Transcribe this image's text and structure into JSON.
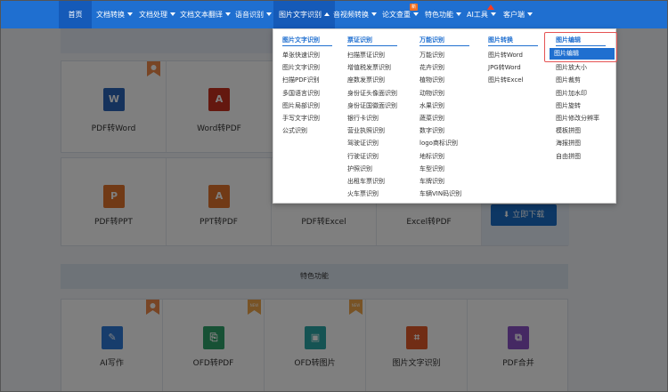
{
  "nav": {
    "items": [
      {
        "label": "首页"
      },
      {
        "label": "文档转换"
      },
      {
        "label": "文档处理"
      },
      {
        "label": "文档文本翻译"
      },
      {
        "label": "语音识别"
      },
      {
        "label": "图片文字识别"
      },
      {
        "label": "音视频转换"
      },
      {
        "label": "论文查重"
      },
      {
        "label": "特色功能"
      },
      {
        "label": "AI工具"
      },
      {
        "label": "客户端"
      }
    ],
    "new_badge": "新"
  },
  "row1": [
    {
      "label": "PDF转Word",
      "icon": "W",
      "icon_color": "#2b64b8"
    },
    {
      "label": "Word转PDF",
      "icon": "A",
      "icon_color": "#c8301f"
    }
  ],
  "row2": [
    {
      "label": "PDF转PPT",
      "icon": "P",
      "icon_color": "#e2752c"
    },
    {
      "label": "PPT转PDF",
      "icon": "A",
      "icon_color": "#e2752c"
    },
    {
      "label": "PDF转Excel"
    },
    {
      "label": "Excel转PDF"
    }
  ],
  "download_label": "立即下载",
  "features_title": "特色功能",
  "row3": [
    {
      "label": "AI写作",
      "icon_color": "#2f7bd9"
    },
    {
      "label": "OFD转PDF",
      "icon_color": "#2fa36a"
    },
    {
      "label": "OFD转图片",
      "icon_color": "#2aa6a6"
    },
    {
      "label": "图片文字识别",
      "icon_color": "#e35b2b"
    },
    {
      "label": "PDF合并",
      "icon_color": "#8a53c6"
    }
  ],
  "ribbon_new": "NEW",
  "dropdown": {
    "columns": [
      {
        "heading": "图片文字识别",
        "items": [
          "单张快速识别",
          "图片文字识别",
          "扫描PDF识别",
          "多国语言识别",
          "图片局部识别",
          "手写文字识别",
          "公式识别"
        ]
      },
      {
        "heading": "票证识别",
        "items": [
          "扫描票证识别",
          "增值税发票识别",
          "座数发票识别",
          "身份证头像面识别",
          "身份证国徽面识别",
          "银行卡识别",
          "营业执照识别",
          "驾驶证识别",
          "行驶证识别",
          "护照识别",
          "出租车票识别",
          "火车票识别"
        ]
      },
      {
        "heading": "万能识别",
        "items": [
          "万能识别",
          "花卉识别",
          "植物识别",
          "动物识别",
          "水果识别",
          "蔬菜识别",
          "数字识别",
          "logo商标识别",
          "地标识别",
          "车型识别",
          "车牌识别",
          "车辆VIN码识别"
        ]
      },
      {
        "heading": "图片转换",
        "items": [
          "图片转Word",
          "JPG转Word",
          "图片转Excel"
        ]
      },
      {
        "heading": "图片编辑",
        "items": [
          "图片编辑",
          "图片放大小",
          "图片裁剪",
          "图片加水印",
          "图片旋转",
          "图片修改分辨率",
          "模板拼图",
          "海报拼图",
          "自由拼图"
        ]
      }
    ]
  },
  "colors": {
    "nav_bg": "#1f6fd0",
    "accent": "#1f6fd0",
    "highlight_border": "#e55353"
  }
}
